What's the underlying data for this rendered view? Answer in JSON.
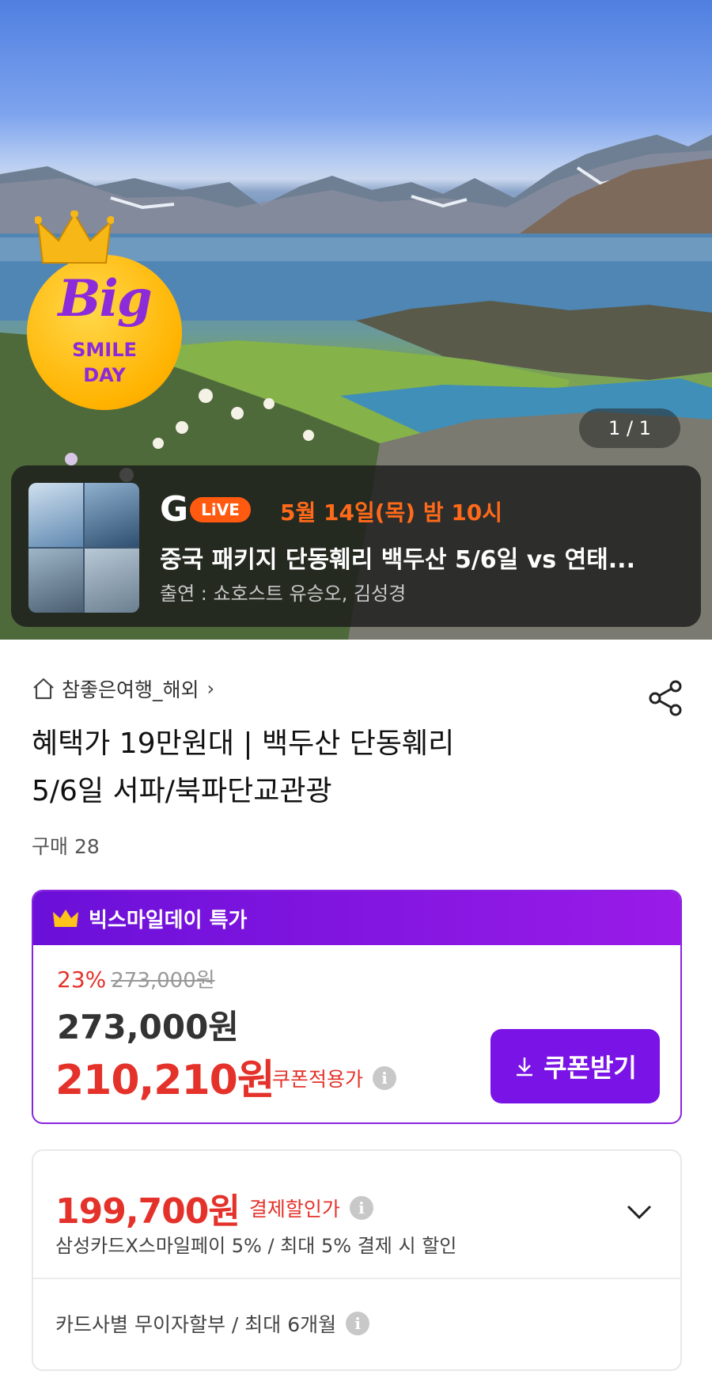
{
  "hero": {
    "pager": "1 / 1",
    "badge": {
      "big": "Big",
      "smile": "SMILE",
      "day": "DAY"
    },
    "live": {
      "logo_g": "G",
      "logo_live": "LiVE",
      "date": "5월 14일(목) 밤 10시",
      "title": "중국 패키지 단동훼리 백두산 5/6일 vs 연태...",
      "cast": "출연 : 쇼호스트 유승오, 김성경"
    }
  },
  "product": {
    "store": "참좋은여행_해외",
    "title_line1": "혜택가 19만원대 | 백두산 단동훼리",
    "title_line2": "5/6일 서파/북파단교관광",
    "purchase_count": "구매 28"
  },
  "deal": {
    "header": "빅스마일데이 특가",
    "discount_rate": "23%",
    "original_price": "273,000원",
    "sale_price": "273,000원",
    "coupon_price": "210,210원",
    "coupon_label": "쿠폰적용가",
    "coupon_button": "쿠폰받기"
  },
  "payment": {
    "price": "199,700원",
    "label": "결제할인가",
    "desc": "삼성카드X스마일페이 5% / 최대 5% 결제 시 할인",
    "installment": "카드사별 무이자할부 / 최대 6개월"
  },
  "colors": {
    "accent_purple": "#7a14e6",
    "price_red": "#e4322b",
    "live_orange": "#ff5a10"
  },
  "icons": [
    "home-icon",
    "chevron-right-icon",
    "share-icon",
    "crown-icon",
    "info-icon",
    "download-icon",
    "chevron-down-icon"
  ]
}
